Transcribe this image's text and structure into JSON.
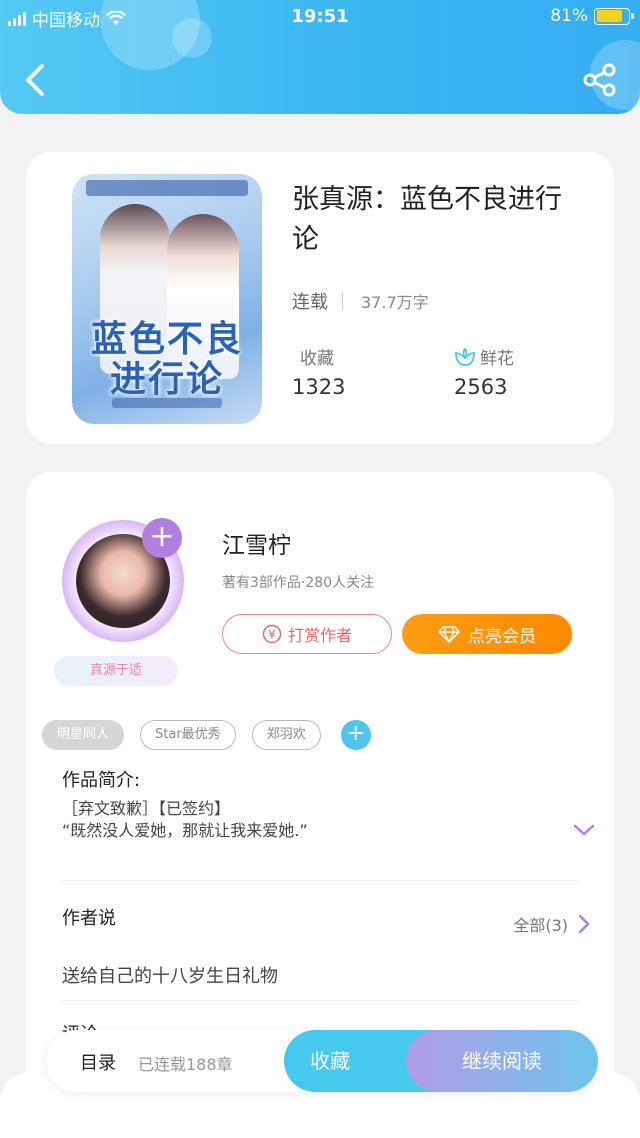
{
  "status_bar": {
    "carrier": "中国移动",
    "time": "19:51",
    "battery": "81%",
    "battery_level": 0.81
  },
  "header": {
    "back_icon": "chevron-left-icon",
    "share_icon": "share-icon"
  },
  "book": {
    "title": "张真源：蓝色不良进行论",
    "status": "连载",
    "word_count": "37.7万字",
    "collect_label": "收藏",
    "collect_count": "1323",
    "flower_label": "鲜花",
    "flower_count": "2563",
    "cover_title": "蓝色不良进行论"
  },
  "author": {
    "name": "江雪柠",
    "info": "著有3部作品·280人关注",
    "badge": "真源于适",
    "reward_label": "打赏作者",
    "vip_label": "点亮会员"
  },
  "tags": [
    {
      "label": "明星同人",
      "active": true
    },
    {
      "label": "Star最优秀",
      "active": false
    },
    {
      "label": "郑羽欢",
      "active": false
    }
  ],
  "intro": {
    "heading": "作品简介:",
    "line1": "［弃文致歉］【已签约】",
    "line2": "“既然没人爱她，那就让我来爱她.”"
  },
  "author_says": {
    "heading": "作者说",
    "all_label": "全部(3)",
    "text": "送给自己的十八岁生日礼物"
  },
  "comments": {
    "heading": "评论"
  },
  "bottom_bar": {
    "toc_label": "目录",
    "chapters": "已连载188章",
    "collect_btn": "收藏",
    "read_btn": "继续阅读"
  },
  "colors": {
    "header": "#38b4f1",
    "vip": "#ff8a00",
    "accent_purple": "#b07fe0",
    "reward": "#e46a6a"
  }
}
